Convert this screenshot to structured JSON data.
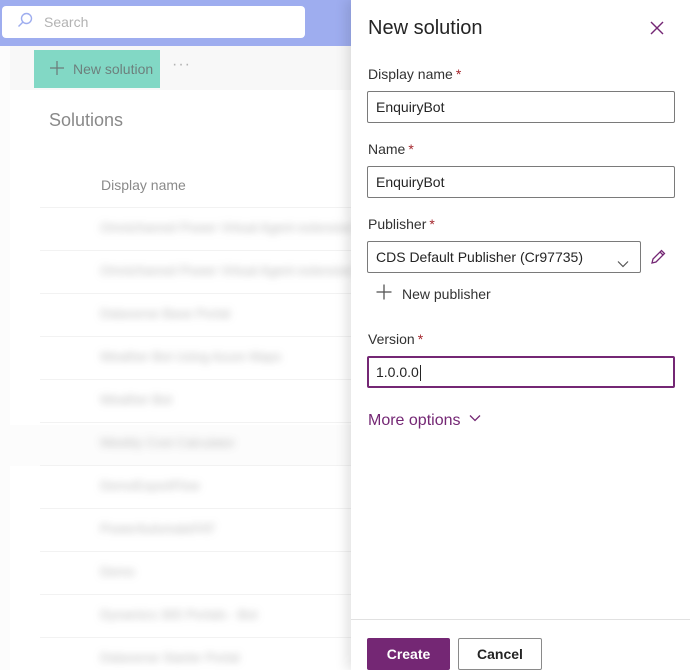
{
  "search": {
    "placeholder": "Search"
  },
  "toolbar": {
    "new_solution_label": "New solution",
    "more_label": "···"
  },
  "solutions": {
    "title": "Solutions",
    "column_header": "Display name",
    "rows": [
      "Omnichannel Power Virtual Agent extension",
      "Omnichannel Power Virtual Agent extension",
      "Dataverse Base Portal",
      "Weather Bot Using Azure Maps",
      "Weather Bot",
      "Weekly Cost Calculator",
      "DemoExportFlow",
      "PowerAutomateFAT",
      "Demo",
      "Dynamics 365 Portals - Bot",
      "Dataverse Starter Portal"
    ]
  },
  "panel": {
    "title": "New solution",
    "display_name": {
      "label": "Display name",
      "value": "EnquiryBot"
    },
    "name": {
      "label": "Name",
      "value": "EnquiryBot"
    },
    "publisher": {
      "label": "Publisher",
      "value": "CDS Default Publisher (Cr97735)",
      "new_label": "New publisher"
    },
    "version": {
      "label": "Version",
      "value": "1.0.0.0"
    },
    "required_mark": "*",
    "more_options_label": "More options",
    "create_label": "Create",
    "cancel_label": "Cancel"
  },
  "colors": {
    "accent": "#742774",
    "header": "#6b82e6",
    "new_button": "#3fc4a6",
    "required": "#a4262c"
  }
}
